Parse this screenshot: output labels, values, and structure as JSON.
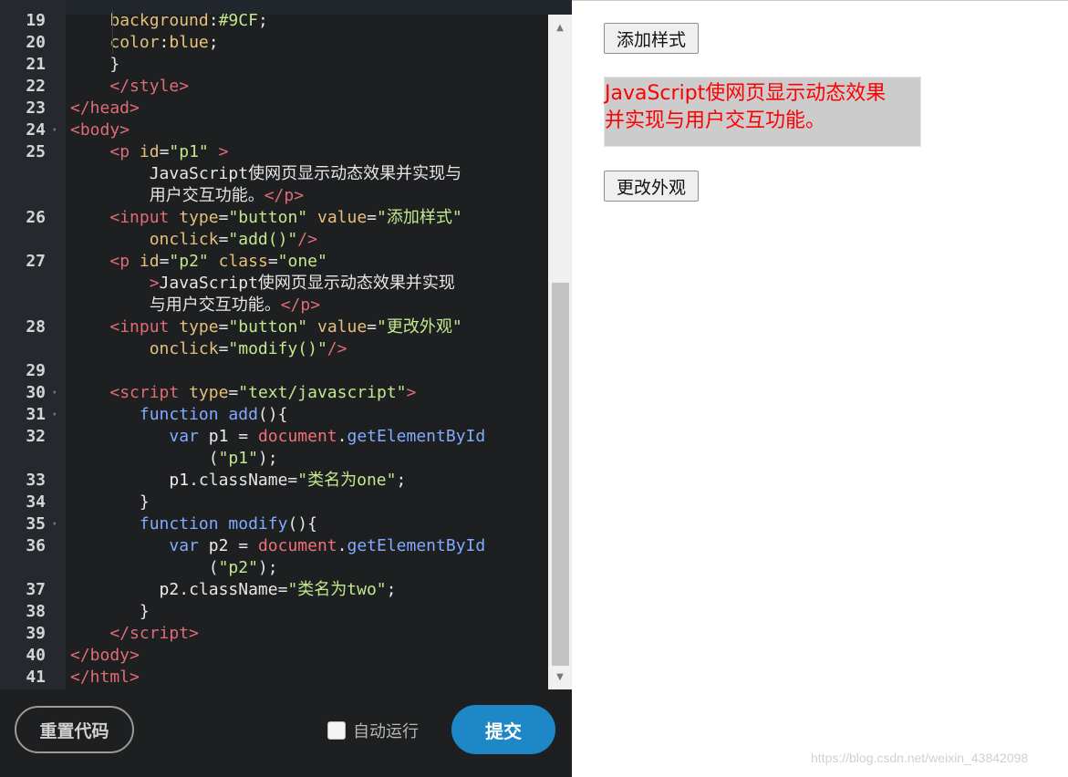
{
  "editor": {
    "lines": [
      {
        "no": "19",
        "fold": "",
        "html": "<span class=\"indent-guide\" style=\"left:46px\"></span>    <span class=\"tok-attr\">background</span>:<span class=\"tok-str\">#9CF</span>;"
      },
      {
        "no": "20",
        "fold": "",
        "html": "<span class=\"indent-guide\" style=\"left:46px\"></span>    <span class=\"tok-attr\">color</span>:<span class=\"tok-prop\">blue</span>;"
      },
      {
        "no": "21",
        "fold": "",
        "html": "    }"
      },
      {
        "no": "22",
        "fold": "",
        "html": "    <span class=\"tok-tag\">&lt;/style&gt;</span>"
      },
      {
        "no": "23",
        "fold": "",
        "html": "<span class=\"tok-tag\">&lt;/head&gt;</span>"
      },
      {
        "no": "24",
        "fold": "▾",
        "html": "<span class=\"tok-tag\">&lt;body&gt;</span>"
      },
      {
        "no": "25",
        "fold": "",
        "html": "    <span class=\"tok-tag\">&lt;p</span> <span class=\"tok-attr\">id</span>=<span class=\"tok-str\">\"p1\"</span> <span class=\"tok-tag\">&gt;</span>"
      },
      {
        "no": "",
        "fold": "",
        "html": "        JavaScript使网页显示动态效果并实现与"
      },
      {
        "no": "",
        "fold": "",
        "html": "        用户交互功能。<span class=\"tok-tag\">&lt;/p&gt;</span>"
      },
      {
        "no": "26",
        "fold": "",
        "html": "    <span class=\"tok-tag\">&lt;input</span> <span class=\"tok-attr\">type</span>=<span class=\"tok-str\">\"button\"</span> <span class=\"tok-attr\">value</span>=<span class=\"tok-str\">\"添加样式\"</span>"
      },
      {
        "no": "",
        "fold": "",
        "html": "        <span class=\"tok-attr\">onclick</span>=<span class=\"tok-str\">\"add()\"</span><span class=\"tok-tag\">/&gt;</span>"
      },
      {
        "no": "27",
        "fold": "",
        "html": "    <span class=\"tok-tag\">&lt;p</span> <span class=\"tok-attr\">id</span>=<span class=\"tok-str\">\"p2\"</span> <span class=\"tok-attr\">class</span>=<span class=\"tok-str\">\"one\"</span>"
      },
      {
        "no": "",
        "fold": "",
        "html": "        <span class=\"tok-tag\">&gt;</span>JavaScript使网页显示动态效果并实现"
      },
      {
        "no": "",
        "fold": "",
        "html": "        与用户交互功能。<span class=\"tok-tag\">&lt;/p&gt;</span>"
      },
      {
        "no": "28",
        "fold": "",
        "html": "    <span class=\"tok-tag\">&lt;input</span> <span class=\"tok-attr\">type</span>=<span class=\"tok-str\">\"button\"</span> <span class=\"tok-attr\">value</span>=<span class=\"tok-str\">\"更改外观\"</span>"
      },
      {
        "no": "",
        "fold": "",
        "html": "        <span class=\"tok-attr\">onclick</span>=<span class=\"tok-str\">\"modify()\"</span><span class=\"tok-tag\">/&gt;</span>"
      },
      {
        "no": "29",
        "fold": "",
        "html": ""
      },
      {
        "no": "30",
        "fold": "▾",
        "html": "    <span class=\"tok-tag\">&lt;script</span> <span class=\"tok-attr\">type</span>=<span class=\"tok-str\">\"text/javascript\"</span><span class=\"tok-tag\">&gt;</span>"
      },
      {
        "no": "31",
        "fold": "▾",
        "html": "       <span class=\"tok-kw\">function</span> <span class=\"tok-fn\">add</span>(){"
      },
      {
        "no": "32",
        "fold": "",
        "html": "          <span class=\"tok-kw\">var</span> <span class=\"tok-var\">p1</span> = <span class=\"tok-obj\">document</span>.<span class=\"tok-fn\">getElementById</span>"
      },
      {
        "no": "",
        "fold": "",
        "html": "              (<span class=\"tok-str\">\"p1\"</span>);"
      },
      {
        "no": "33",
        "fold": "",
        "html": "          <span class=\"tok-var\">p1</span>.className=<span class=\"tok-str\">\"类名为one\"</span>;"
      },
      {
        "no": "34",
        "fold": "",
        "html": "       }"
      },
      {
        "no": "35",
        "fold": "▾",
        "html": "       <span class=\"tok-kw\">function</span> <span class=\"tok-fn\">modify</span>(){"
      },
      {
        "no": "36",
        "fold": "",
        "html": "          <span class=\"tok-kw\">var</span> <span class=\"tok-var\">p2</span> = <span class=\"tok-obj\">document</span>.<span class=\"tok-fn\">getElementById</span>"
      },
      {
        "no": "",
        "fold": "",
        "html": "              (<span class=\"tok-str\">\"p2\"</span>);"
      },
      {
        "no": "37",
        "fold": "",
        "html": "         <span class=\"tok-var\">p2</span>.className=<span class=\"tok-str\">\"类名为two\"</span>;"
      },
      {
        "no": "38",
        "fold": "",
        "html": "       }"
      },
      {
        "no": "39",
        "fold": "",
        "html": "    <span class=\"tok-tag\">&lt;/script&gt;</span>"
      },
      {
        "no": "40",
        "fold": "",
        "html": "<span class=\"tok-tag\">&lt;/body&gt;</span>"
      },
      {
        "no": "41",
        "fold": "",
        "html": "<span class=\"tok-tag\">&lt;/html&gt;</span>"
      }
    ]
  },
  "footer": {
    "reset_label": "重置代码",
    "autorun_label": "自动运行",
    "submit_label": "提交"
  },
  "preview": {
    "add_style_button": "添加样式",
    "paragraph_line1": "JavaScript使网页显示动态效果",
    "paragraph_line2": "并实现与用户交互功能。",
    "modify_button": "更改外观"
  },
  "watermark": "https://blog.csdn.net/weixin_43842098",
  "colors": {
    "submit": "#1e88c7",
    "paragraph_text": "#ff0000",
    "paragraph_bg": "#cccccc"
  }
}
